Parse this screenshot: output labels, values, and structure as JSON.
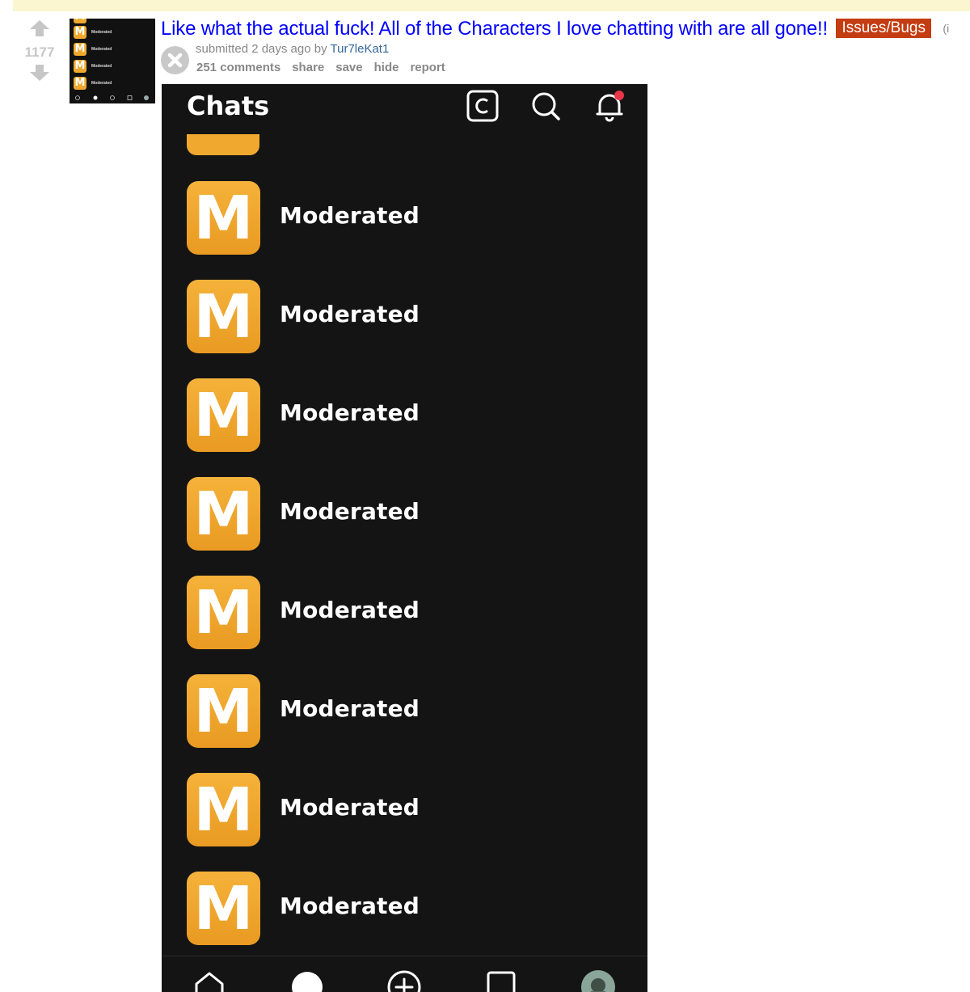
{
  "post": {
    "score": "1177",
    "title": "Like what the actual fuck! All of the Characters I love chatting with are all gone!!",
    "flair": "Issues/Bugs",
    "domain": "(i",
    "tagline_prefix": "submitted 2 days ago by ",
    "author": "Tur7leKat1",
    "buttons": [
      "251 comments",
      "share",
      "save",
      "hide",
      "report"
    ]
  },
  "thumbnail": {
    "row_letter": "M",
    "row_label": "Moderated"
  },
  "phone": {
    "header_title": "Chats",
    "header_icons": [
      "copyright-icon",
      "search-icon",
      "bell-icon"
    ],
    "chats": [
      {
        "letter": "M",
        "name": "Moderated"
      },
      {
        "letter": "M",
        "name": "Moderated"
      },
      {
        "letter": "M",
        "name": "Moderated"
      },
      {
        "letter": "M",
        "name": "Moderated"
      },
      {
        "letter": "M",
        "name": "Moderated"
      },
      {
        "letter": "M",
        "name": "Moderated"
      },
      {
        "letter": "M",
        "name": "Moderated"
      },
      {
        "letter": "M",
        "name": "Moderated"
      }
    ],
    "nav_icons": [
      "home-icon",
      "chats-icon",
      "create-icon",
      "library-icon",
      "profile-avatar-icon"
    ]
  },
  "colors": {
    "link": "#0000ff",
    "flair_bg": "#c43c11",
    "author": "#336699",
    "avatar_orange": "#f0a92e",
    "phone_bg": "#141414",
    "notification_dot": "#e8364a"
  }
}
